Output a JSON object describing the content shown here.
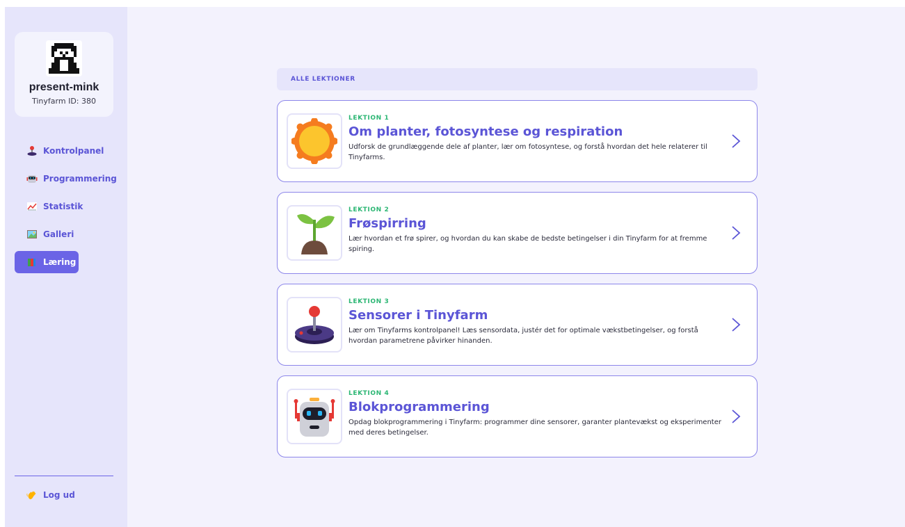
{
  "profile": {
    "username": "present-mink",
    "tinyfarm_id": "Tinyfarm ID: 380"
  },
  "nav": {
    "items": [
      {
        "label": "Kontrolpanel",
        "icon": "joystick-icon",
        "active": false
      },
      {
        "label": "Programmering",
        "icon": "robot-icon",
        "active": false
      },
      {
        "label": "Statistik",
        "icon": "chart-icon",
        "active": false
      },
      {
        "label": "Galleri",
        "icon": "picture-icon",
        "active": false
      },
      {
        "label": "Læring",
        "icon": "books-icon",
        "active": true
      }
    ],
    "logout": {
      "label": "Log ud",
      "icon": "waving-hand-icon"
    }
  },
  "main": {
    "section_title": "ALLE LEKTIONER",
    "lessons": [
      {
        "number": "LEKTION 1",
        "title": "Om planter, fotosyntese og respiration",
        "description": "Udforsk de grundlæggende dele af planter, lær om fotosyntese, og forstå hvordan det hele relaterer til Tinyfarms.",
        "icon": "sun-icon"
      },
      {
        "number": "LEKTION 2",
        "title": "Frøspirring",
        "description": "Lær hvordan et frø spirer, og hvordan du kan skabe de bedste betingelser i din Tinyfarm for at fremme spiring.",
        "icon": "seedling-icon"
      },
      {
        "number": "LEKTION 3",
        "title": "Sensorer i Tinyfarm",
        "description": "Lær om Tinyfarms kontrolpanel! Læs sensordata, justér det for optimale vækstbetingelser, og forstå hvordan parametrene påvirker hinanden.",
        "icon": "joystick-icon"
      },
      {
        "number": "LEKTION 4",
        "title": "Blokprogrammering",
        "description": "Opdag blokprogrammering i Tinyfarm: programmer dine sensorer, garanter plantevækst og eksperimenter med deres betingelser.",
        "icon": "robot-icon"
      }
    ]
  },
  "colors": {
    "accent": "#5b55d6",
    "active_nav": "#6b64e6",
    "lesson_number": "#2bb673",
    "card_border": "#8c86ea",
    "sidebar_bg": "#e6e5fb",
    "page_bg": "#f3f2fd"
  }
}
